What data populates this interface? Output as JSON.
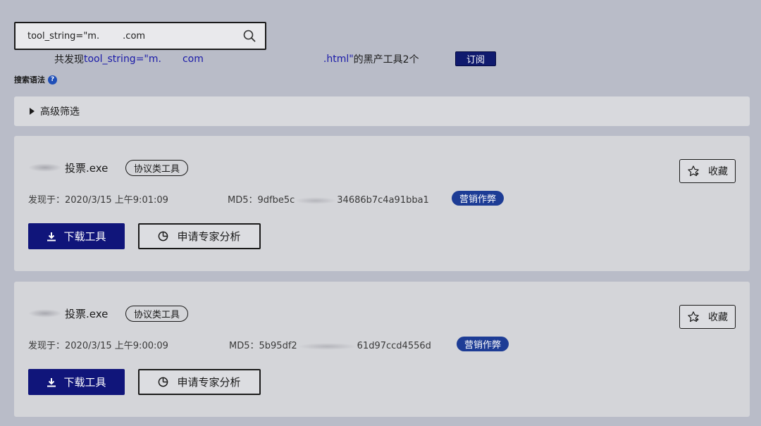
{
  "search": {
    "value": "tool_string=\"m.        .com"
  },
  "summary": {
    "prefix": "共发现",
    "query_start": "tool_string=\"m.",
    "query_mid": "com",
    "query_end": ".html\"",
    "suffix": "的黑产工具2个",
    "subscribe_label": "订阅"
  },
  "syntax_label": "搜索语法",
  "help_icon_glyph": "?",
  "advanced_filter_label": "高级筛选",
  "results": [
    {
      "name": "投票.exe",
      "type_tag": "协议类工具",
      "found_label": "发现于：2020/3/15 上午9:01:09",
      "md5_prefix": "MD5：9dfbe5c",
      "md5_suffix": "34686b7c4a91bba1",
      "category": "营销作弊",
      "favorite_label": "收藏",
      "download_label": "下载工具",
      "expert_label": "申请专家分析"
    },
    {
      "name": "投票.exe",
      "type_tag": "协议类工具",
      "found_label": "发现于：2020/3/15 上午9:00:09",
      "md5_prefix": "MD5：5b95df2",
      "md5_suffix": "61d97ccd4556d",
      "category": "营销作弊",
      "favorite_label": "收藏",
      "download_label": "下载工具",
      "expert_label": "申请专家分析"
    }
  ],
  "colors": {
    "background": "#b9bcc8",
    "primary": "#10157a",
    "badge": "#1d3c95",
    "query_link": "#1a1aa8"
  }
}
